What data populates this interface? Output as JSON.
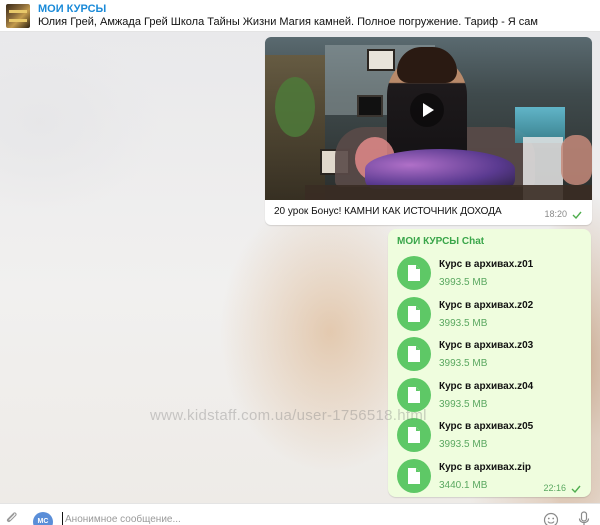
{
  "header": {
    "title": "МОИ КУРСЫ",
    "subtitle": "Юлия Грей, Амжада Грей Школа Тайны Жизни Магия камней. Полное погружение. Тариф - Я сам"
  },
  "video_message": {
    "caption": "20 урок Бонус! КАМНИ КАК ИСТОЧНИК ДОХОДА",
    "time": "18:20"
  },
  "files_message": {
    "sender": "МОИ КУРСЫ Chat",
    "files": [
      {
        "name": "Курс в архивах.z01",
        "size": "3993.5 MB"
      },
      {
        "name": "Курс в архивах.z02",
        "size": "3993.5 MB"
      },
      {
        "name": "Курс в архивах.z03",
        "size": "3993.5 MB"
      },
      {
        "name": "Курс в архивах.z04",
        "size": "3993.5 MB"
      },
      {
        "name": "Курс в архивах.z05",
        "size": "3993.5 MB"
      },
      {
        "name": "Курс в архивах.zip",
        "size": "3440.1 MB"
      }
    ],
    "time": "22:16"
  },
  "watermark": "www.kidstaff.com.ua/user-1756518.html",
  "input": {
    "user_initials": "МС",
    "placeholder": "Анонимное сообщение..."
  },
  "colors": {
    "accent": "#1a8ad8",
    "outgoing_bubble": "#effdde",
    "file_icon": "#5ec866",
    "sender_name": "#3aa64a"
  },
  "icons": [
    "play-icon",
    "file-icon",
    "check-icon",
    "attach-icon",
    "emoji-icon",
    "mic-icon"
  ]
}
